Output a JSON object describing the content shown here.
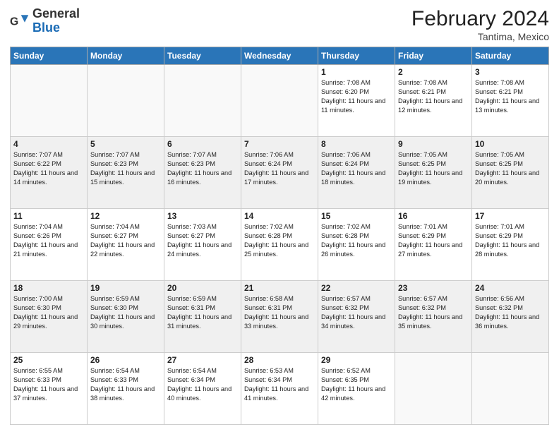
{
  "logo": {
    "text_general": "General",
    "text_blue": "Blue"
  },
  "header": {
    "month_year": "February 2024",
    "location": "Tantima, Mexico"
  },
  "days_of_week": [
    "Sunday",
    "Monday",
    "Tuesday",
    "Wednesday",
    "Thursday",
    "Friday",
    "Saturday"
  ],
  "weeks": [
    [
      {
        "day": "",
        "info": ""
      },
      {
        "day": "",
        "info": ""
      },
      {
        "day": "",
        "info": ""
      },
      {
        "day": "",
        "info": ""
      },
      {
        "day": "1",
        "info": "Sunrise: 7:08 AM\nSunset: 6:20 PM\nDaylight: 11 hours and 11 minutes."
      },
      {
        "day": "2",
        "info": "Sunrise: 7:08 AM\nSunset: 6:21 PM\nDaylight: 11 hours and 12 minutes."
      },
      {
        "day": "3",
        "info": "Sunrise: 7:08 AM\nSunset: 6:21 PM\nDaylight: 11 hours and 13 minutes."
      }
    ],
    [
      {
        "day": "4",
        "info": "Sunrise: 7:07 AM\nSunset: 6:22 PM\nDaylight: 11 hours and 14 minutes."
      },
      {
        "day": "5",
        "info": "Sunrise: 7:07 AM\nSunset: 6:23 PM\nDaylight: 11 hours and 15 minutes."
      },
      {
        "day": "6",
        "info": "Sunrise: 7:07 AM\nSunset: 6:23 PM\nDaylight: 11 hours and 16 minutes."
      },
      {
        "day": "7",
        "info": "Sunrise: 7:06 AM\nSunset: 6:24 PM\nDaylight: 11 hours and 17 minutes."
      },
      {
        "day": "8",
        "info": "Sunrise: 7:06 AM\nSunset: 6:24 PM\nDaylight: 11 hours and 18 minutes."
      },
      {
        "day": "9",
        "info": "Sunrise: 7:05 AM\nSunset: 6:25 PM\nDaylight: 11 hours and 19 minutes."
      },
      {
        "day": "10",
        "info": "Sunrise: 7:05 AM\nSunset: 6:25 PM\nDaylight: 11 hours and 20 minutes."
      }
    ],
    [
      {
        "day": "11",
        "info": "Sunrise: 7:04 AM\nSunset: 6:26 PM\nDaylight: 11 hours and 21 minutes."
      },
      {
        "day": "12",
        "info": "Sunrise: 7:04 AM\nSunset: 6:27 PM\nDaylight: 11 hours and 22 minutes."
      },
      {
        "day": "13",
        "info": "Sunrise: 7:03 AM\nSunset: 6:27 PM\nDaylight: 11 hours and 24 minutes."
      },
      {
        "day": "14",
        "info": "Sunrise: 7:02 AM\nSunset: 6:28 PM\nDaylight: 11 hours and 25 minutes."
      },
      {
        "day": "15",
        "info": "Sunrise: 7:02 AM\nSunset: 6:28 PM\nDaylight: 11 hours and 26 minutes."
      },
      {
        "day": "16",
        "info": "Sunrise: 7:01 AM\nSunset: 6:29 PM\nDaylight: 11 hours and 27 minutes."
      },
      {
        "day": "17",
        "info": "Sunrise: 7:01 AM\nSunset: 6:29 PM\nDaylight: 11 hours and 28 minutes."
      }
    ],
    [
      {
        "day": "18",
        "info": "Sunrise: 7:00 AM\nSunset: 6:30 PM\nDaylight: 11 hours and 29 minutes."
      },
      {
        "day": "19",
        "info": "Sunrise: 6:59 AM\nSunset: 6:30 PM\nDaylight: 11 hours and 30 minutes."
      },
      {
        "day": "20",
        "info": "Sunrise: 6:59 AM\nSunset: 6:31 PM\nDaylight: 11 hours and 31 minutes."
      },
      {
        "day": "21",
        "info": "Sunrise: 6:58 AM\nSunset: 6:31 PM\nDaylight: 11 hours and 33 minutes."
      },
      {
        "day": "22",
        "info": "Sunrise: 6:57 AM\nSunset: 6:32 PM\nDaylight: 11 hours and 34 minutes."
      },
      {
        "day": "23",
        "info": "Sunrise: 6:57 AM\nSunset: 6:32 PM\nDaylight: 11 hours and 35 minutes."
      },
      {
        "day": "24",
        "info": "Sunrise: 6:56 AM\nSunset: 6:32 PM\nDaylight: 11 hours and 36 minutes."
      }
    ],
    [
      {
        "day": "25",
        "info": "Sunrise: 6:55 AM\nSunset: 6:33 PM\nDaylight: 11 hours and 37 minutes."
      },
      {
        "day": "26",
        "info": "Sunrise: 6:54 AM\nSunset: 6:33 PM\nDaylight: 11 hours and 38 minutes."
      },
      {
        "day": "27",
        "info": "Sunrise: 6:54 AM\nSunset: 6:34 PM\nDaylight: 11 hours and 40 minutes."
      },
      {
        "day": "28",
        "info": "Sunrise: 6:53 AM\nSunset: 6:34 PM\nDaylight: 11 hours and 41 minutes."
      },
      {
        "day": "29",
        "info": "Sunrise: 6:52 AM\nSunset: 6:35 PM\nDaylight: 11 hours and 42 minutes."
      },
      {
        "day": "",
        "info": ""
      },
      {
        "day": "",
        "info": ""
      }
    ]
  ]
}
